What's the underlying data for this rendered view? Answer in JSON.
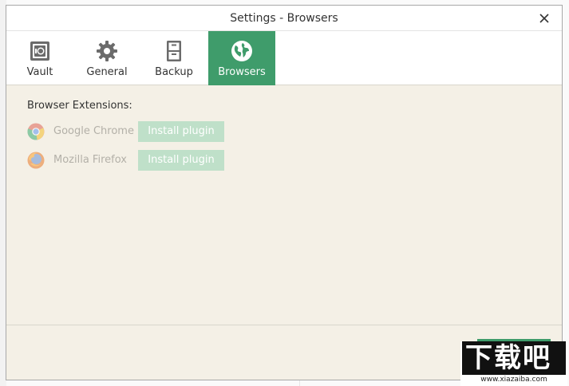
{
  "window": {
    "title": "Settings - Browsers",
    "close_icon": "close-icon"
  },
  "tabs": [
    {
      "label": "Vault",
      "icon": "vault-icon",
      "active": false
    },
    {
      "label": "General",
      "icon": "gear-icon",
      "active": false
    },
    {
      "label": "Backup",
      "icon": "cabinet-icon",
      "active": false
    },
    {
      "label": "Browsers",
      "icon": "globe-icon",
      "active": true
    }
  ],
  "browsers": {
    "section_label": "Browser Extensions:",
    "items": [
      {
        "name": "Google Chrome",
        "icon": "chrome-icon",
        "button_label": "Install plugin"
      },
      {
        "name": "Mozilla Firefox",
        "icon": "firefox-icon",
        "button_label": "Install plugin"
      }
    ]
  },
  "watermark": {
    "logo_text": "下载吧",
    "url_text": "www.xiazaiba.com"
  },
  "colors": {
    "accent": "#3f9c6b",
    "accent_disabled": "#bfe0c9",
    "dialog_bg": "#f4f0e6"
  }
}
